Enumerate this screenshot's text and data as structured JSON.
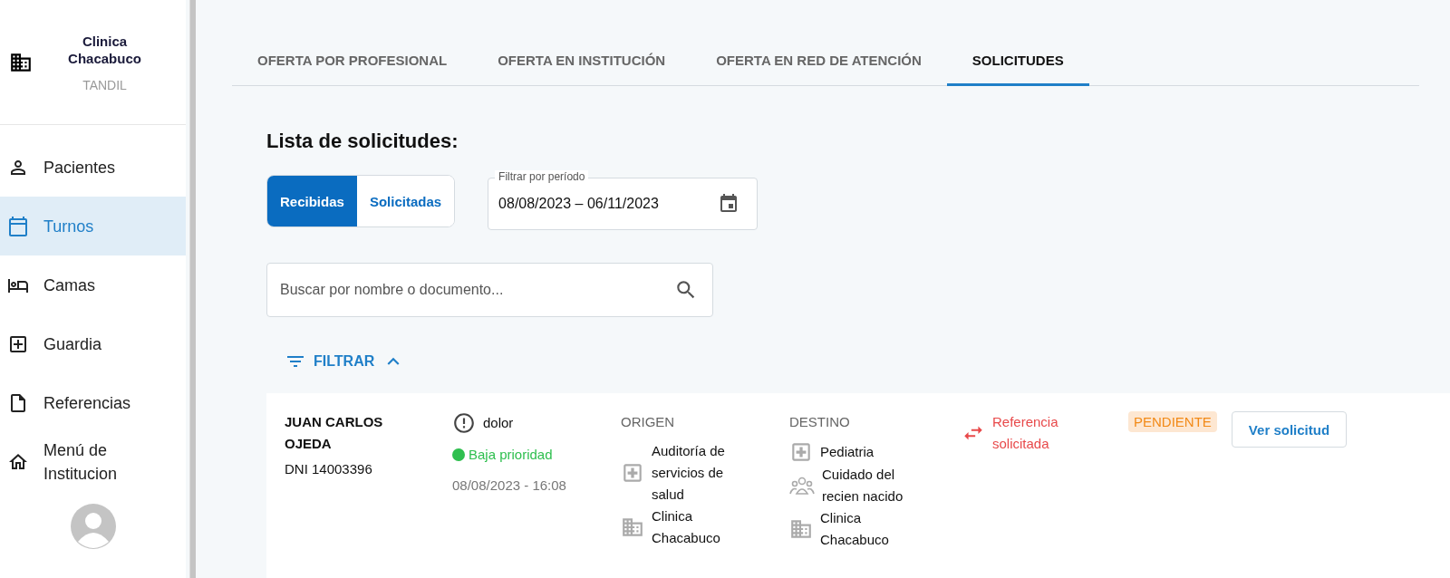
{
  "sidebar": {
    "institution": {
      "name": "Clinica Chacabuco",
      "city": "TANDIL"
    },
    "items": [
      {
        "label": "Pacientes",
        "kind": "person",
        "selected": false
      },
      {
        "label": "Turnos",
        "kind": "calendar",
        "selected": true
      },
      {
        "label": "Camas",
        "kind": "bed",
        "selected": false
      },
      {
        "label": "Guardia",
        "kind": "plus",
        "selected": false
      },
      {
        "label": "Referencias",
        "kind": "document",
        "selected": false
      },
      {
        "label": "Menú de Institucion",
        "kind": "home",
        "selected": false
      }
    ]
  },
  "tabs": [
    {
      "label": "OFERTA POR PROFESIONAL",
      "selected": false
    },
    {
      "label": "OFERTA EN INSTITUCIÓN",
      "selected": false
    },
    {
      "label": "OFERTA EN RED DE ATENCIÓN",
      "selected": false
    },
    {
      "label": "SOLICITUDES",
      "selected": true
    }
  ],
  "heading": "Lista de solicitudes:",
  "toggle": [
    {
      "label": "Recibidas",
      "selected": true
    },
    {
      "label": "Solicitadas",
      "selected": false
    }
  ],
  "date_filter": {
    "label": "Filtrar por período",
    "value": "08/08/2023 – 06/11/2023"
  },
  "search": {
    "placeholder": "Buscar por nombre o documento..."
  },
  "filter_button": {
    "label": "FILTRAR",
    "expanded": true
  },
  "requests": [
    {
      "patient_name": "JUAN CARLOS OJEDA",
      "document": "DNI 14003396",
      "reason": "dolor",
      "priority": {
        "label": "Baja prioridad",
        "color": "#2fbf4f"
      },
      "datetime": "08/08/2023 - 16:08",
      "origin": {
        "label": "ORIGEN",
        "specialty": "Auditoría de servicios de salud",
        "institution": "Clinica Chacabuco"
      },
      "destination": {
        "label": "DESTINO",
        "specialty": "Pediatria",
        "care_line": "Cuidado del recien nacido",
        "institution": "Clinica Chacabuco"
      },
      "reference": "Referencia solicitada",
      "status": "PENDIENTE",
      "action": "Ver solicitud"
    }
  ]
}
